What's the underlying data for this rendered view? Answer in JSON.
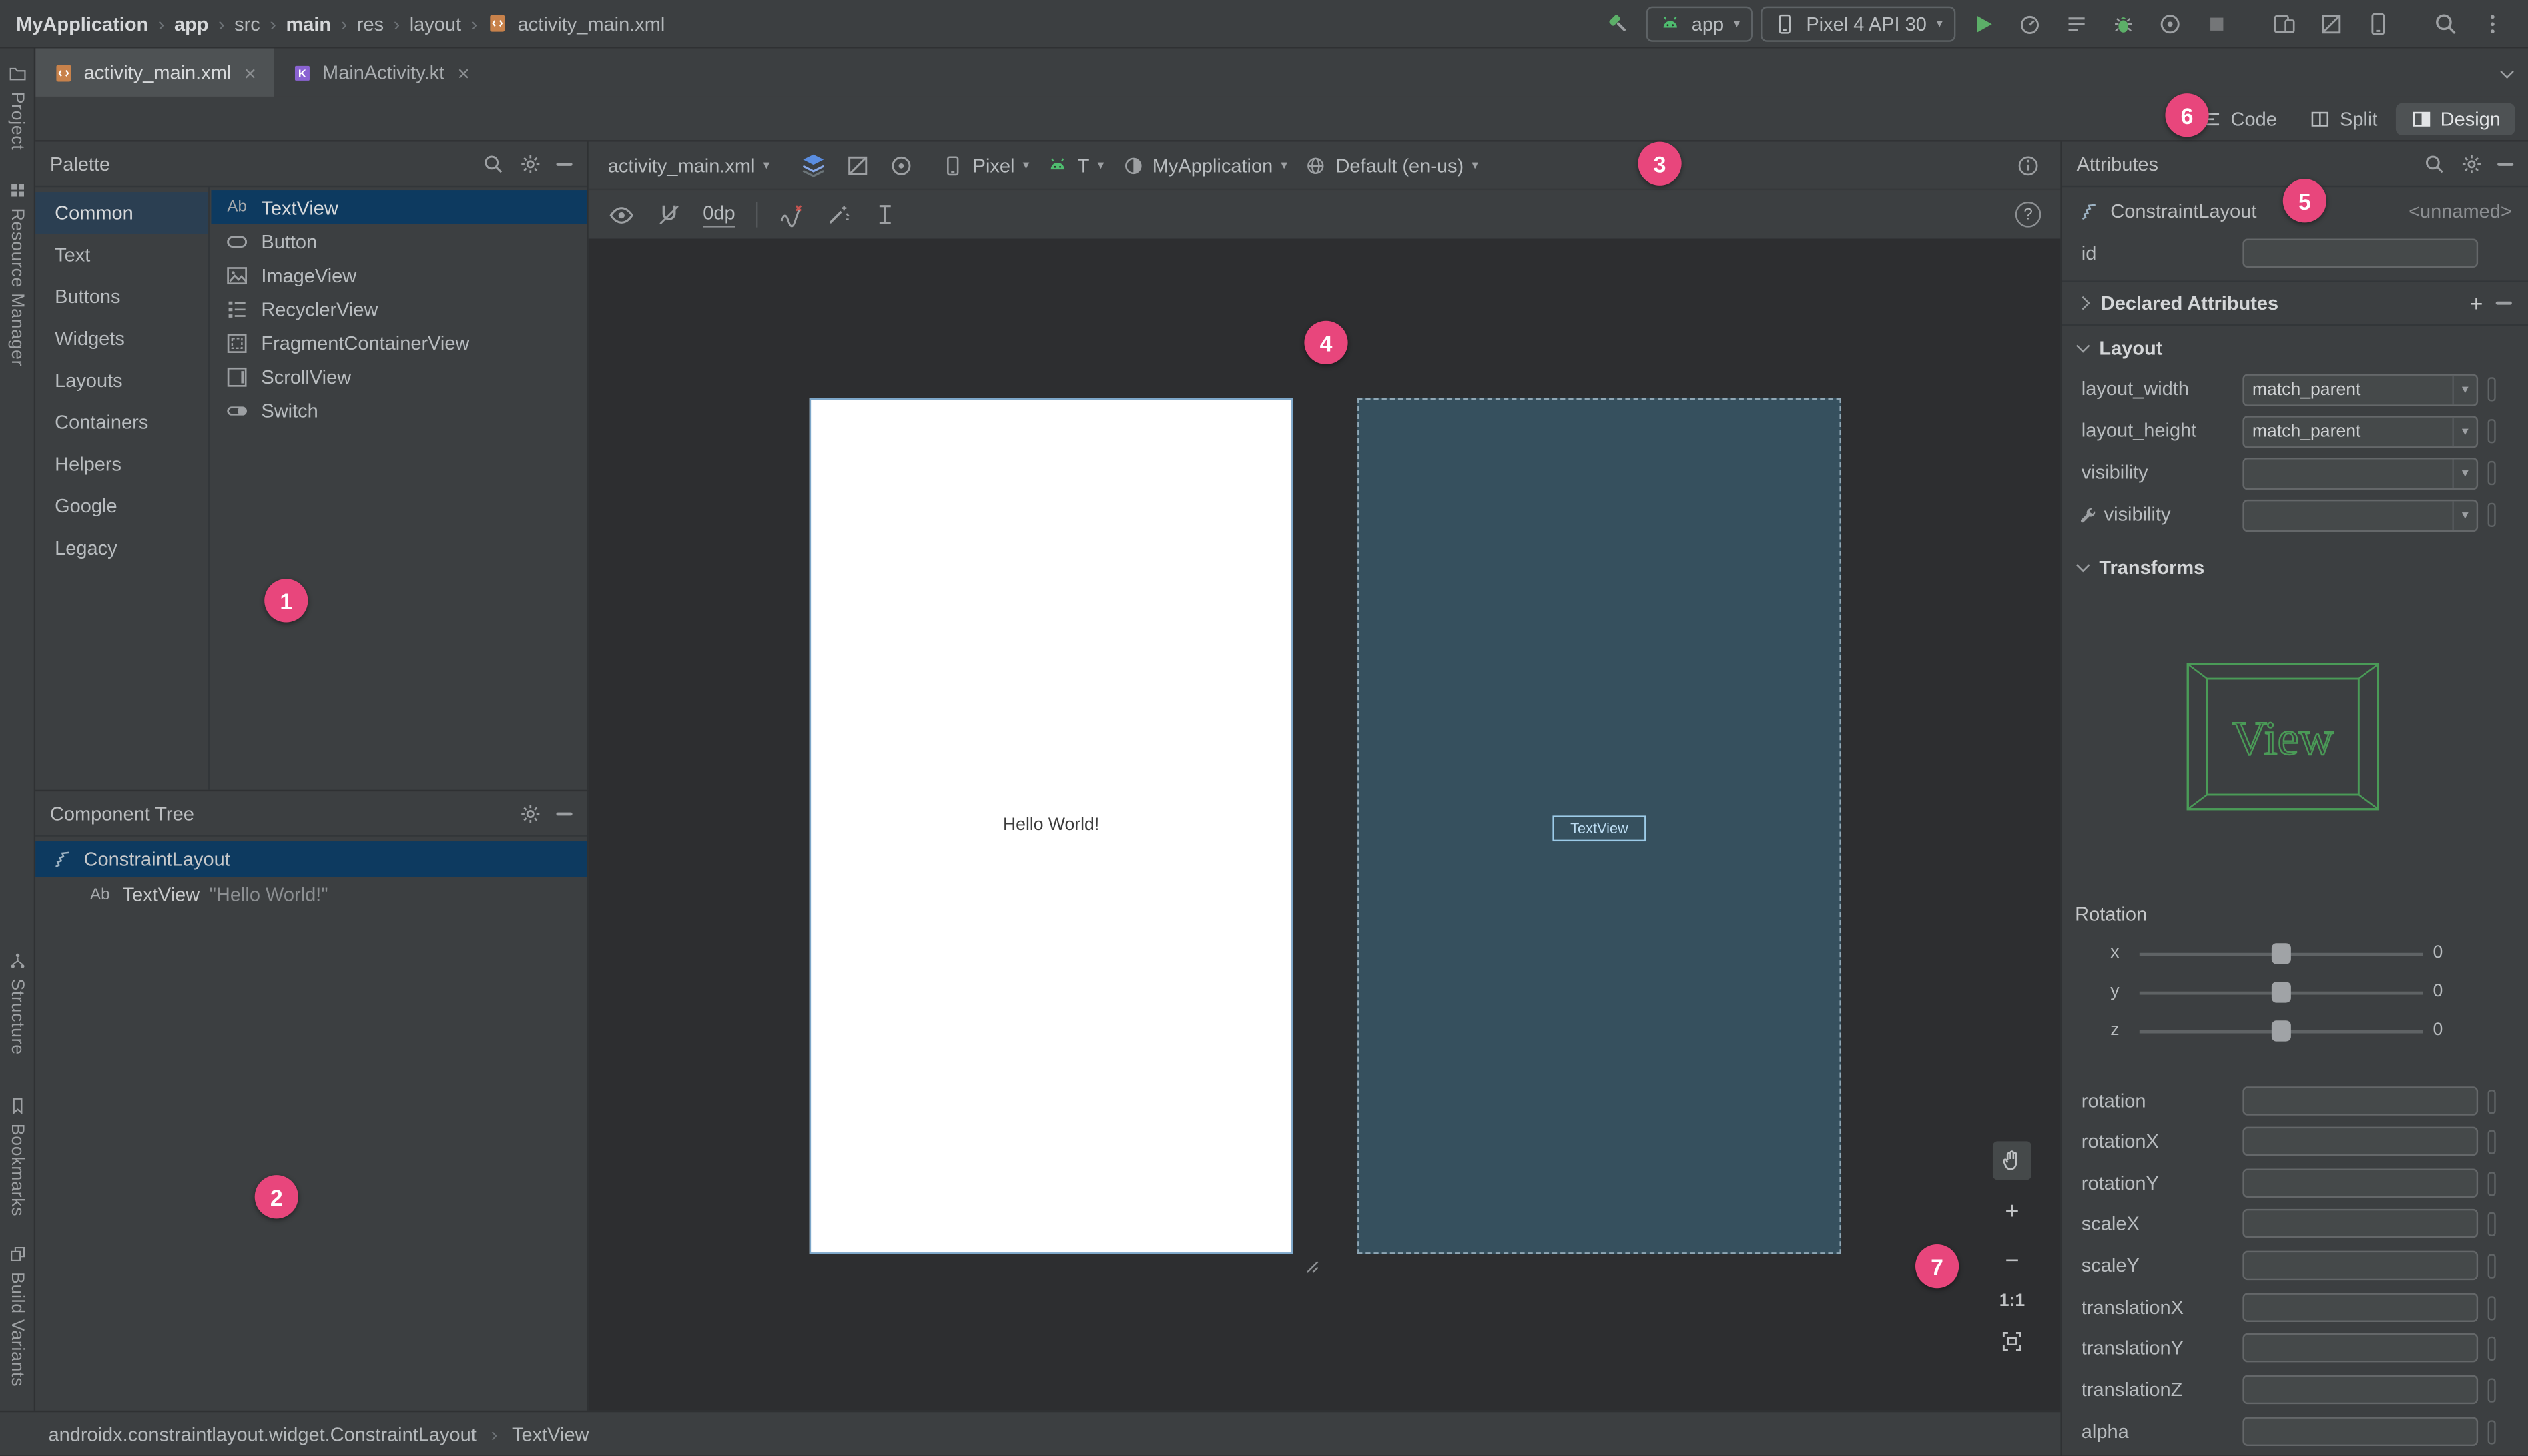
{
  "topbar": {
    "breadcrumbs": [
      "MyApplication",
      "app",
      "src",
      "main",
      "res",
      "layout",
      "activity_main.xml"
    ],
    "sep": "›",
    "run_config": "app",
    "device": "Pixel 4 API 30"
  },
  "tabs": {
    "tab1": "activity_main.xml",
    "tab2": "MainActivity.kt",
    "close": "×"
  },
  "stripe": {
    "project": "Project",
    "resource_manager": "Resource Manager",
    "structure": "Structure",
    "bookmarks": "Bookmarks",
    "build_variants": "Build Variants"
  },
  "modes": {
    "code": "Code",
    "split": "Split",
    "design": "Design"
  },
  "palette": {
    "title": "Palette",
    "categories": [
      "Common",
      "Text",
      "Buttons",
      "Widgets",
      "Layouts",
      "Containers",
      "Helpers",
      "Google",
      "Legacy"
    ],
    "components": [
      "TextView",
      "Button",
      "ImageView",
      "RecyclerView",
      "FragmentContainerView",
      "ScrollView",
      "Switch"
    ],
    "ab_icon": "Ab"
  },
  "tree": {
    "title": "Component Tree",
    "root": "ConstraintLayout",
    "child": "TextView",
    "child_text": "\"Hello World!\"",
    "ab_icon": "Ab"
  },
  "design_toolbar": {
    "file": "activity_main.xml",
    "device": "Pixel",
    "api": "T",
    "theme": "MyApplication",
    "locale": "Default (en-us)",
    "margin": "0dp",
    "help": "?"
  },
  "canvas": {
    "hello": "Hello World!",
    "blueprint_label": "TextView"
  },
  "zoom": {
    "plus": "+",
    "minus": "−",
    "ratio": "1:1"
  },
  "attrs": {
    "title": "Attributes",
    "component": "ConstraintLayout",
    "instance": "<unnamed>",
    "id_label": "id",
    "declared": "Declared Attributes",
    "add": "+",
    "layout_section": "Layout",
    "transforms_section": "Transforms",
    "rows": [
      {
        "label": "layout_width",
        "value": "match_parent"
      },
      {
        "label": "layout_height",
        "value": "match_parent"
      },
      {
        "label": "visibility",
        "value": ""
      },
      {
        "label": "visibility",
        "value": ""
      }
    ],
    "view_text": "View",
    "rotation_title": "Rotation",
    "axes": [
      {
        "a": "x",
        "v": "0"
      },
      {
        "a": "y",
        "v": "0"
      },
      {
        "a": "z",
        "v": "0"
      }
    ],
    "fields": [
      "rotation",
      "rotationX",
      "rotationY",
      "scaleX",
      "scaleY",
      "translationX",
      "translationY",
      "translationZ",
      "alpha"
    ]
  },
  "status": {
    "path": "androidx.constraintlayout.widget.ConstraintLayout",
    "sep": "›",
    "node": "TextView"
  },
  "badges": [
    "1",
    "2",
    "3",
    "4",
    "5",
    "6",
    "7"
  ],
  "icons": {
    "kotlin": "K",
    "caret": "▾"
  }
}
